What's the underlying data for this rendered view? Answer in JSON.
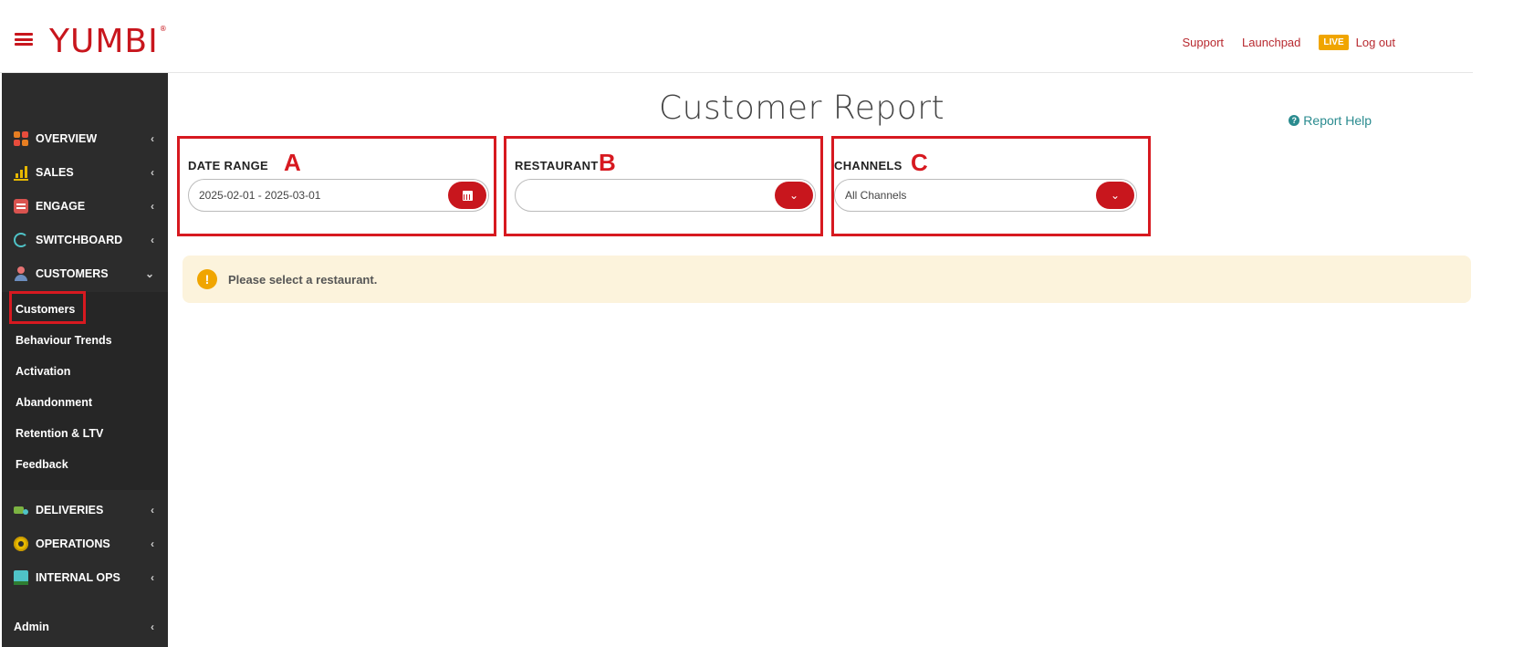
{
  "header": {
    "logo": "YUMBI",
    "logo_mark": "®",
    "nav": {
      "support": "Support",
      "launchpad": "Launchpad",
      "live": "LIVE",
      "logout": "Log out"
    }
  },
  "sidebar": {
    "items": [
      {
        "label": "OVERVIEW",
        "icon": "overview-icon"
      },
      {
        "label": "SALES",
        "icon": "sales-icon"
      },
      {
        "label": "ENGAGE",
        "icon": "engage-icon"
      },
      {
        "label": "SWITCHBOARD",
        "icon": "switchboard-icon"
      },
      {
        "label": "CUSTOMERS",
        "icon": "customers-icon"
      },
      {
        "label": "DELIVERIES",
        "icon": "deliveries-icon"
      },
      {
        "label": "OPERATIONS",
        "icon": "operations-icon"
      },
      {
        "label": "INTERNAL OPS",
        "icon": "internal-ops-icon"
      },
      {
        "label": "Admin",
        "icon": ""
      }
    ],
    "submenu": [
      "Customers",
      "Behaviour Trends",
      "Activation",
      "Abandonment",
      "Retention & LTV",
      "Feedback"
    ],
    "chev_collapsed": "‹",
    "chev_expanded": "⌄"
  },
  "main": {
    "title": "Customer Report",
    "help": "Report Help",
    "help_icon_glyph": "?",
    "filters": {
      "date_range": {
        "label": "DATE RANGE",
        "marker": "A",
        "value": "2025-02-01 - 2025-03-01"
      },
      "restaurant": {
        "label": "RESTAURANT",
        "marker": "B",
        "value": ""
      },
      "channels": {
        "label": "CHANNELS",
        "marker": "C",
        "value": "All Channels"
      }
    },
    "alert": {
      "glyph": "!",
      "text": "Please select a restaurant."
    }
  },
  "colors": {
    "brand": "#c8161d",
    "annotation": "#d71920",
    "sidebar_bg": "#2c2c2c",
    "live": "#f0a500",
    "alert_bg": "#fcf3dc"
  }
}
